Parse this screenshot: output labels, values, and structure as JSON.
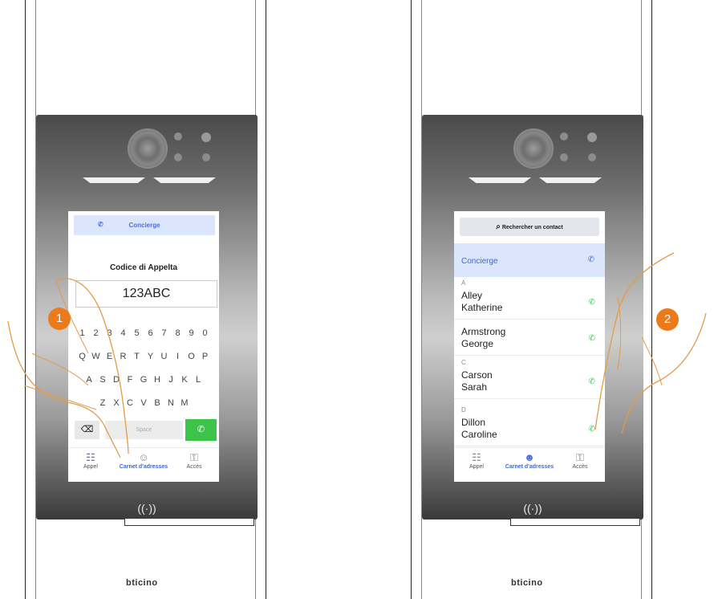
{
  "brand": "bticino",
  "nfc_symbol": "((·))",
  "panel1": {
    "step": "1",
    "concierge_label": "Concierge",
    "code_label": "Codice di Appelta",
    "code_value": "123ABC",
    "keys_row1": [
      "1",
      "2",
      "3",
      "4",
      "5",
      "6",
      "7",
      "8",
      "9",
      "0"
    ],
    "keys_row2": [
      "Q",
      "W",
      "E",
      "R",
      "T",
      "Y",
      "U",
      "I",
      "O",
      "P"
    ],
    "keys_row3": [
      "A",
      "S",
      "D",
      "F",
      "G",
      "H",
      "J",
      "K",
      "L"
    ],
    "keys_row4": [
      "Z",
      "X",
      "C",
      "V",
      "B",
      "N",
      "M"
    ],
    "space_label": "Space",
    "nav": {
      "call": "Appel",
      "addressbook": "Carnet d'adresses",
      "access": "Accès"
    }
  },
  "panel2": {
    "step": "2",
    "search_label": "Rechercher un contact",
    "concierge_label": "Concierge",
    "contacts": [
      {
        "letter": "A",
        "name": "Alley\nKatherine"
      },
      {
        "letter": "",
        "name": "Armstrong\nGeorge"
      },
      {
        "letter": "C",
        "name": "Carson\nSarah"
      },
      {
        "letter": "D",
        "name": "Dillon\nCaroline"
      }
    ],
    "nav": {
      "call": "Appel",
      "addressbook": "Carnet d'adresses",
      "access": "Accès"
    }
  }
}
